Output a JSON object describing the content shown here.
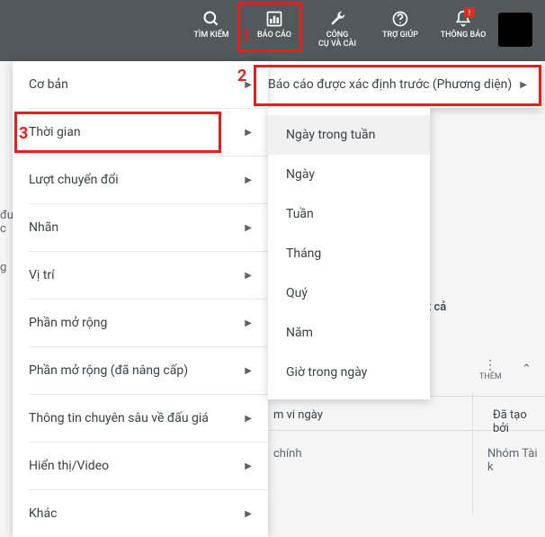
{
  "topbar": {
    "search": "TÌM KIẾM",
    "report": "BÁO CÁO",
    "tools": "CÔNG\nCỤ VÀ CÀI",
    "help": "TRỢ GIÚP",
    "notif": "THÔNG BÁO",
    "alert": "!"
  },
  "menu": {
    "items": [
      "Cơ bản",
      "Thời gian",
      "Lượt chuyển đổi",
      "Nhãn",
      "Vị trí",
      "Phần mở rộng",
      "Phần mở rộng (đã nâng cấp)",
      "Thông tin chuyên sâu về đấu giá",
      "Hiển thị/Video",
      "Khác"
    ]
  },
  "submenu_first": "Báo cáo được xác định trước (Phương diện)",
  "submenu_time": [
    "Ngày trong tuần",
    "Ngày",
    "Tuần",
    "Tháng",
    "Quý",
    "Năm",
    "Giờ trong ngày"
  ],
  "annotations": {
    "n1": "1",
    "n2": "2",
    "n3": "3"
  },
  "background": {
    "xem": "Xem tất cả",
    "them": "THÊM",
    "mvi": "m vi ngày",
    "chinh": "chính",
    "datao": "Đã tạo bởi",
    "nhom": "Nhóm Tài k",
    "du": "đư",
    "g": "g",
    "c": "c"
  }
}
